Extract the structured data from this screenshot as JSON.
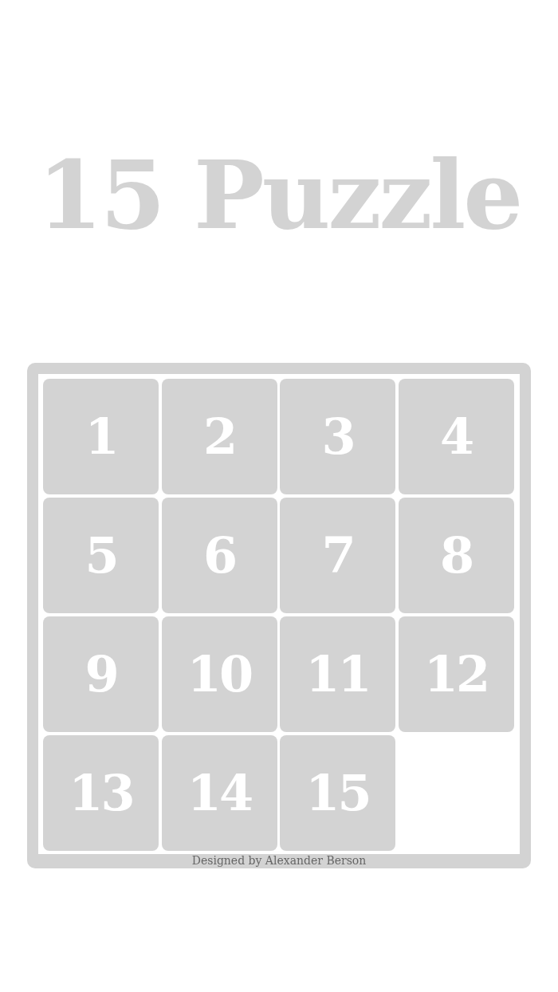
{
  "title": "15 Puzzle",
  "tiles": [
    {
      "kind": "tile",
      "label": "1"
    },
    {
      "kind": "tile",
      "label": "2"
    },
    {
      "kind": "tile",
      "label": "3"
    },
    {
      "kind": "tile",
      "label": "4"
    },
    {
      "kind": "tile",
      "label": "5"
    },
    {
      "kind": "tile",
      "label": "6"
    },
    {
      "kind": "tile",
      "label": "7"
    },
    {
      "kind": "tile",
      "label": "8"
    },
    {
      "kind": "tile",
      "label": "9"
    },
    {
      "kind": "tile",
      "label": "10"
    },
    {
      "kind": "tile",
      "label": "11"
    },
    {
      "kind": "tile",
      "label": "12"
    },
    {
      "kind": "tile",
      "label": "13"
    },
    {
      "kind": "tile",
      "label": "14"
    },
    {
      "kind": "tile",
      "label": "15"
    },
    {
      "kind": "blank"
    }
  ],
  "footer": "Designed by Alexander Berson"
}
